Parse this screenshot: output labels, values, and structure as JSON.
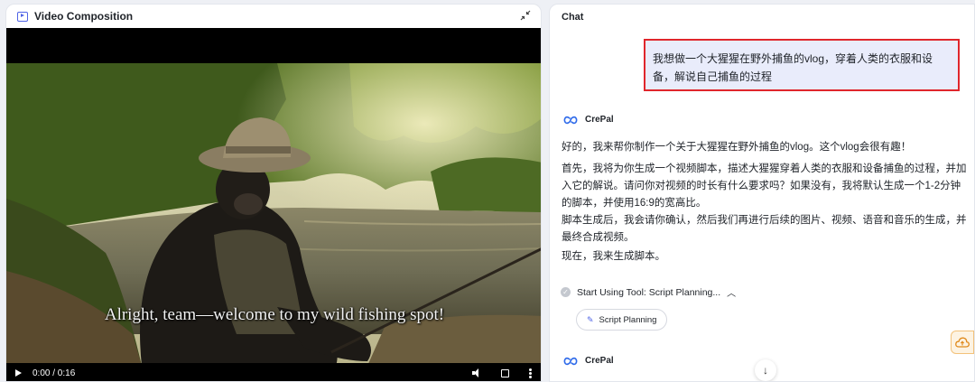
{
  "left_panel": {
    "title": "Video Composition",
    "icons": {
      "title_icon": "video-icon",
      "collapse_icon": "collapse-arrows-icon"
    },
    "video": {
      "subtitle": "Alright, team—welcome to my wild fishing spot!",
      "time": "0:00 / 0:16",
      "icons": [
        "play-icon",
        "volume-icon",
        "fullscreen-icon",
        "more-icon"
      ]
    }
  },
  "chat": {
    "title": "Chat",
    "user_message": "我想做一个大猩猩在野外捕鱼的vlog，穿着人类的衣服和设备，解说自己捕鱼的过程",
    "agent_name": "CrePal",
    "agent_messages": [
      "好的，我来帮你制作一个关于大猩猩在野外捕鱼的vlog。这个vlog会很有趣！",
      "首先，我将为你生成一个视频脚本，描述大猩猩穿着人类的衣服和设备捕鱼的过程，并加入它的解说。请问你对视频的时长有什么要求吗？如果没有，我将默认生成一个1-2分钟的脚本，并使用16:9的宽高比。",
      "脚本生成后，我会请你确认，然后我们再进行后续的图片、视频、语音和音乐的生成，并最终合成视频。",
      "现在，我来生成脚本。"
    ],
    "tool_status": "Start Using Tool: Script Planning...",
    "tool_chip": "Script Planning",
    "second_agent_name": "CrePal"
  },
  "colors": {
    "accent": "#4f63e6",
    "highlight_border": "#e0262c",
    "user_bubble": "#e9ecfb"
  }
}
